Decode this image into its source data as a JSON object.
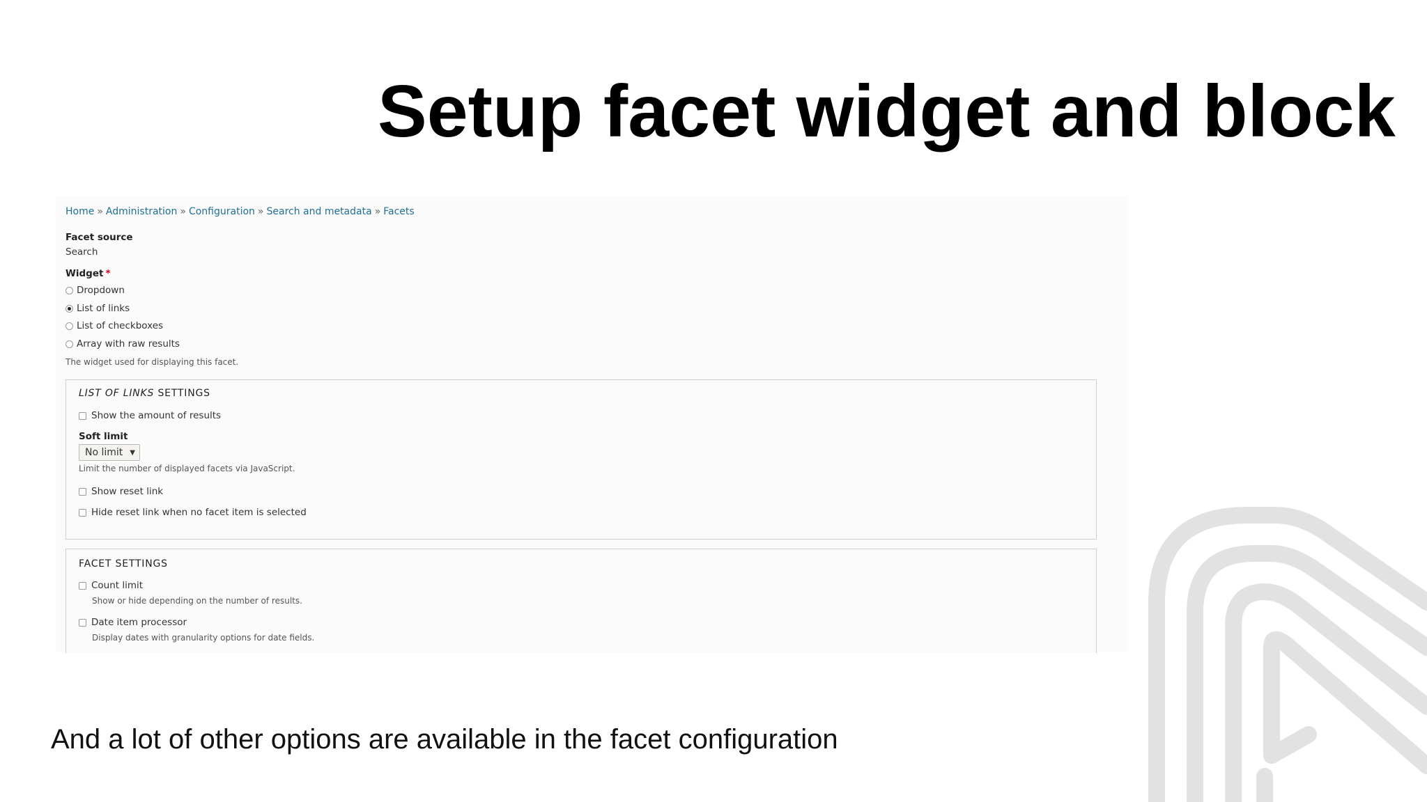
{
  "slide": {
    "title": "Setup facet widget and block",
    "caption": "And a lot of other options are available in the facet configuration"
  },
  "breadcrumb": [
    "Home",
    "Administration",
    "Configuration",
    "Search and metadata",
    "Facets"
  ],
  "breadcrumb_separator": "»",
  "facet_source": {
    "label": "Facet source",
    "value": "Search"
  },
  "widget": {
    "label": "Widget",
    "required_mark": "*",
    "options": [
      {
        "label": "Dropdown",
        "selected": false
      },
      {
        "label": "List of links",
        "selected": true
      },
      {
        "label": "List of checkboxes",
        "selected": false
      },
      {
        "label": "Array with raw results",
        "selected": false
      }
    ],
    "description": "The widget used for displaying this facet."
  },
  "list_of_links_settings": {
    "legend_italic": "LIST OF LINKS",
    "legend_rest": " SETTINGS",
    "show_amount": "Show the amount of results",
    "soft_limit_label": "Soft limit",
    "soft_limit_value": "No limit",
    "soft_limit_description": "Limit the number of displayed facets via JavaScript.",
    "show_reset": "Show reset link",
    "hide_reset": "Hide reset link when no facet item is selected"
  },
  "facet_settings": {
    "legend": "FACET SETTINGS",
    "count_limit": "Count limit",
    "count_limit_description": "Show or hide depending on the number of results.",
    "date_processor": "Date item processor",
    "date_processor_description": "Display dates with granularity options for date fields."
  },
  "colors": {
    "link": "#1f6f94",
    "required": "#d0021b",
    "logo": "#e2e2e2"
  },
  "icons": {
    "logo": "brand-logo-outline",
    "select_arrow": "triangle-down"
  }
}
